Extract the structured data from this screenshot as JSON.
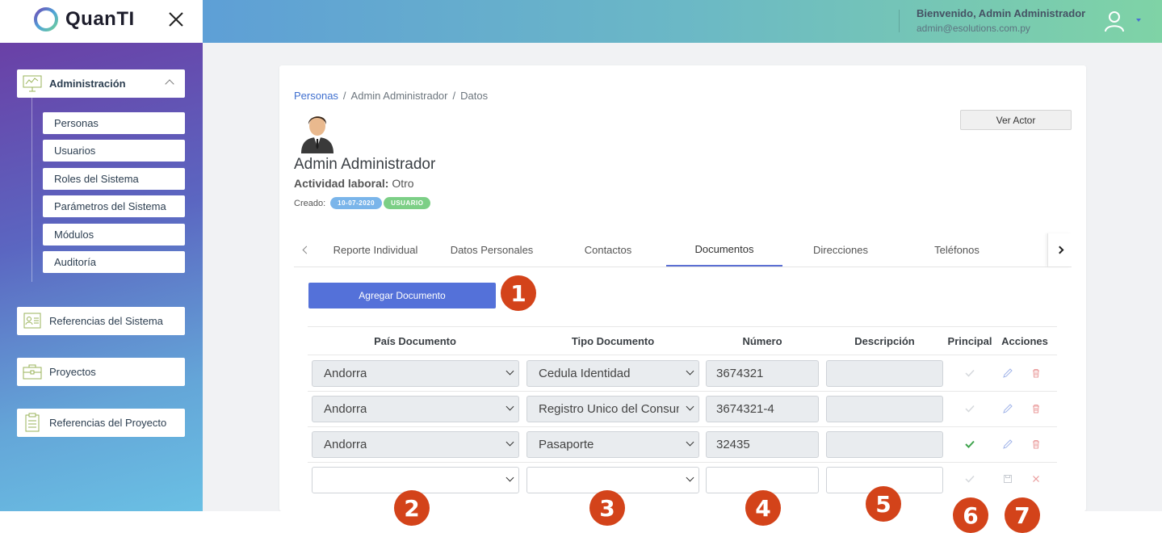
{
  "app": {
    "logo_text": "QuanTI",
    "welcome": "Bienvenido, Admin Administrador",
    "email": "admin@esolutions.com.py"
  },
  "sidebar": {
    "admin_label": "Administración",
    "sub_items": [
      "Personas",
      "Usuarios",
      "Roles del Sistema",
      "Parámetros del Sistema",
      "Módulos",
      "Auditoría"
    ],
    "referencias_sistema": "Referencias del Sistema",
    "proyectos": "Proyectos",
    "referencias_proyecto": "Referencias del Proyecto"
  },
  "breadcrumb": {
    "items": [
      "Personas",
      "Admin Administrador",
      "Datos"
    ],
    "separator": "/"
  },
  "profile": {
    "name": "Admin Administrador",
    "actividad_label": "Actividad laboral:",
    "actividad_value": "Otro",
    "creado_label": "Creado:",
    "date_badge": "10-07-2020",
    "role_badge": "USUARIO",
    "ver_actor": "Ver Actor"
  },
  "tabs": [
    "Reporte Individual",
    "Datos Personales",
    "Contactos",
    "Documentos",
    "Direcciones",
    "Teléfonos"
  ],
  "active_tab": "Documentos",
  "add_button": "Agregar Documento",
  "table": {
    "headers": [
      "País Documento",
      "Tipo Documento",
      "Número",
      "Descripción",
      "Principal",
      "Acciones"
    ],
    "rows": [
      {
        "pais": "Andorra",
        "tipo": "Cedula Identidad",
        "numero": "3674321",
        "descripcion": "",
        "principal": false
      },
      {
        "pais": "Andorra",
        "tipo": "Registro Unico del Consum",
        "numero": "3674321-4",
        "descripcion": "",
        "principal": false
      },
      {
        "pais": "Andorra",
        "tipo": "Pasaporte",
        "numero": "32435",
        "descripcion": "",
        "principal": true
      }
    ],
    "new_row": {
      "pais": "",
      "tipo": "",
      "numero": "",
      "descripcion": ""
    }
  },
  "markers": [
    "1",
    "2",
    "3",
    "4",
    "5",
    "6",
    "7"
  ],
  "colors": {
    "accent": "#5471d9",
    "marker": "#d3431a",
    "check_active": "#3fa34d",
    "delete": "#e88c8c",
    "badge_date": "#7ab5ea",
    "badge_user": "#7ccf86"
  },
  "icons": {
    "close": "close-icon",
    "user": "user-avatar-icon",
    "edit": "pencil-icon",
    "delete": "trash-icon",
    "save": "save-icon",
    "cancel": "close-icon",
    "check": "check-icon"
  }
}
